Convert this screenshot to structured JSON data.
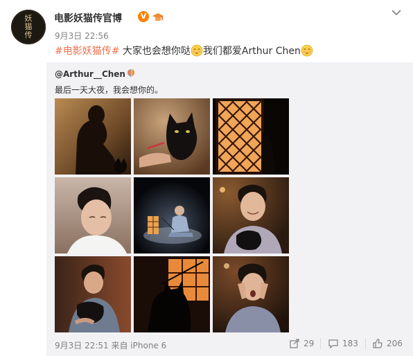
{
  "post": {
    "avatar_text": "妖猫传",
    "author": "电影妖猫传官博",
    "verified_badge": "V",
    "time": "9月3日 22:56",
    "topic": "#电影妖猫传#",
    "text_part1": " 大家也会想你哒",
    "text_part2": "我们都爱Arthur Chen"
  },
  "repost": {
    "user": "@Arthur__Chen",
    "text": "最后一天大夜，我会想你的。",
    "photos": [
      "silhouette-man-cat",
      "black-cat-hand",
      "lattice-lantern",
      "young-man-portrait",
      "man-sitting-lantern-stage",
      "man-holding-cat",
      "man-hugging-cat",
      "cat-silhouette-window",
      "hands-on-face"
    ],
    "meta": "9月3日 22:51 来自 iPhone 6",
    "actions": {
      "share_count": "29",
      "comment_count": "183",
      "like_count": "206"
    }
  },
  "colors": {
    "topic": "#eb7350",
    "verified": "#ff8200",
    "repost_bg": "#f2f2f5",
    "meta": "#808080"
  }
}
